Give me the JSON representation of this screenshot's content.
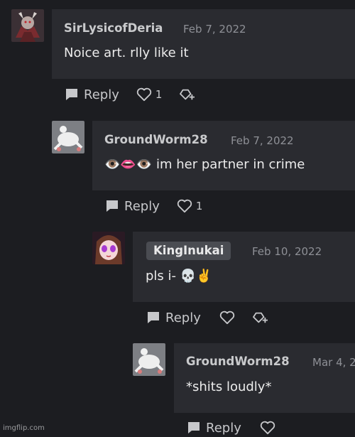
{
  "comments": [
    {
      "username": "SirLysicofDeria",
      "date": "Feb 7, 2022",
      "text": "Noice art. rlly like it",
      "reply_label": "Reply",
      "like_count": "1",
      "avatar_icon": "demon-warrior-avatar"
    },
    {
      "username": "GroundWorm28",
      "date": "Feb 7, 2022",
      "text": "👁️👄👁️ im her partner in crime",
      "reply_label": "Reply",
      "like_count": "1",
      "avatar_icon": "white-creature-avatar"
    },
    {
      "username": "KingInukai",
      "date": "Feb 10, 2022",
      "text": "pls i- 💀✌️",
      "reply_label": "Reply",
      "like_count": "",
      "avatar_icon": "anime-girl-avatar"
    },
    {
      "username": "GroundWorm28",
      "date": "Mar 4, 2",
      "text": "*shits loudly*",
      "reply_label": "Reply",
      "like_count": "",
      "avatar_icon": "white-creature-avatar"
    }
  ],
  "watermark": "imgflip.com",
  "colors": {
    "background": "#1c1d21",
    "card": "#2a2b30",
    "badge": "#4a4c52",
    "text": "#ececec",
    "muted": "#8e9096"
  }
}
